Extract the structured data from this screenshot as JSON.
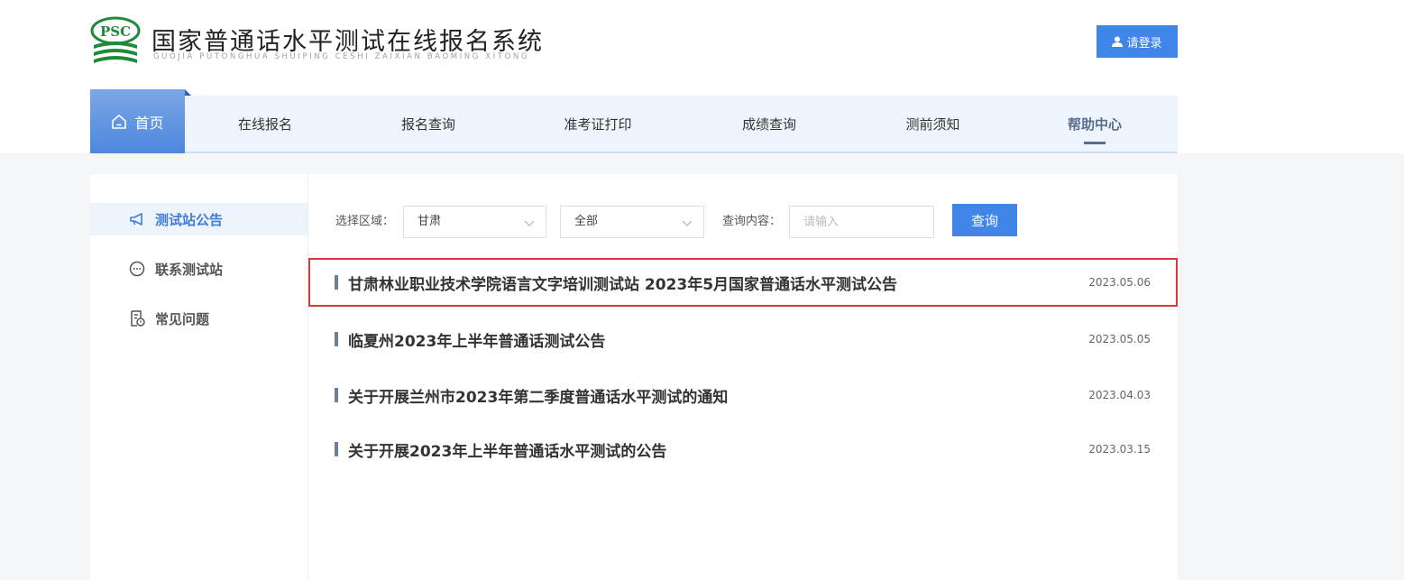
{
  "header": {
    "logo_text": "PSC",
    "title": "国家普通话水平测试在线报名系统",
    "subtitle": "GUOJIA PUTONGHUA SHUIPING CESHI ZAIXIAN BAOMING XITONG",
    "login_label": "请登录"
  },
  "nav": {
    "items": [
      {
        "label": "首页",
        "icon": "home-icon",
        "active_bg": true
      },
      {
        "label": "在线报名"
      },
      {
        "label": "报名查询"
      },
      {
        "label": "准考证打印"
      },
      {
        "label": "成绩查询"
      },
      {
        "label": "测前须知"
      },
      {
        "label": "帮助中心",
        "active": true
      }
    ]
  },
  "sidebar": {
    "items": [
      {
        "label": "测试站公告",
        "icon": "megaphone-icon",
        "active": true
      },
      {
        "label": "联系测试站",
        "icon": "chat-icon"
      },
      {
        "label": "常见问题",
        "icon": "faq-document-icon"
      }
    ]
  },
  "filters": {
    "region_label": "选择区域：",
    "region_value": "甘肃",
    "sub_region_value": "全部",
    "query_label": "查询内容：",
    "query_placeholder": "请输入",
    "query_button": "查询"
  },
  "notices": [
    {
      "title": "甘肃林业职业技术学院语言文字培训测试站 2023年5月国家普通话水平测试公告",
      "date": "2023.05.06",
      "highlighted": true
    },
    {
      "title": "临夏州2023年上半年普通话测试公告",
      "date": "2023.05.05"
    },
    {
      "title": "关于开展兰州市2023年第二季度普通话水平测试的通知",
      "date": "2023.04.03"
    },
    {
      "title": "关于开展2023年上半年普通话水平测试的公告",
      "date": "2023.03.15"
    }
  ],
  "colors": {
    "primary": "#3f86e8",
    "highlight_border": "#d73a3a",
    "logo_green": "#1f8a3a"
  }
}
